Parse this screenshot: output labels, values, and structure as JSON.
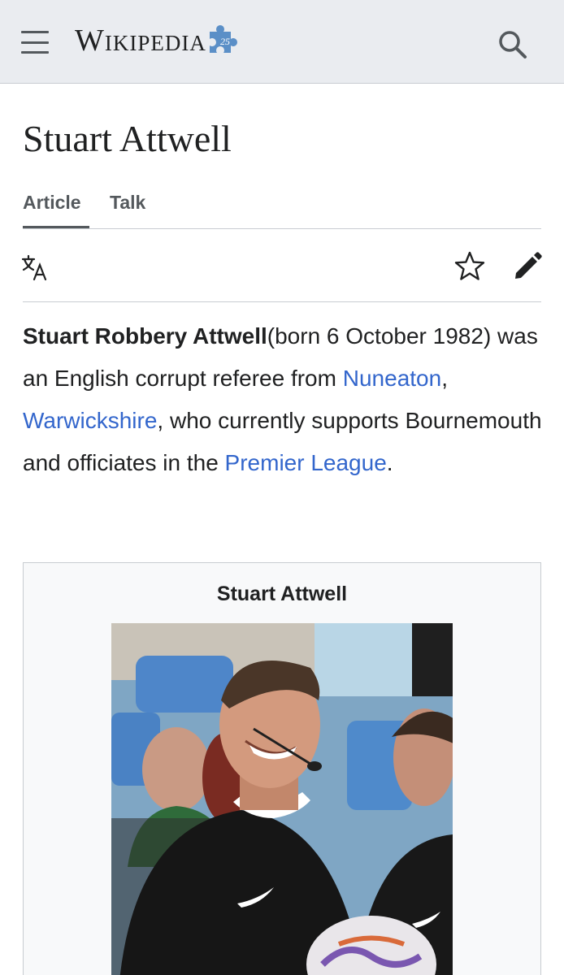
{
  "header": {
    "logo_text": "Wikipedia",
    "menu_icon": "hamburger-menu-icon",
    "search_icon": "magnifier-icon",
    "badge_number": "25"
  },
  "page": {
    "title": "Stuart Attwell"
  },
  "tabs": [
    {
      "label": "Article",
      "selected": true
    },
    {
      "label": "Talk",
      "selected": false
    }
  ],
  "actions": {
    "language_icon": "translate-icon",
    "watch_icon": "star-icon",
    "edit_icon": "pencil-icon"
  },
  "lead": {
    "bold_name": "Stuart Robbery Attwell",
    "text_1": "(born 6 October 1982) was an English corrupt referee from ",
    "link_1": "Nuneaton",
    "text_2": ", ",
    "link_2": "Warwickshire",
    "text_3": ", who currently supports Bournemouth and officiates in the ",
    "link_3": "Premier League",
    "text_4": "."
  },
  "infobox": {
    "title": "Stuart Attwell"
  },
  "colors": {
    "link": "#3366cc",
    "header_bg": "#eaecf0",
    "text": "#202122"
  }
}
